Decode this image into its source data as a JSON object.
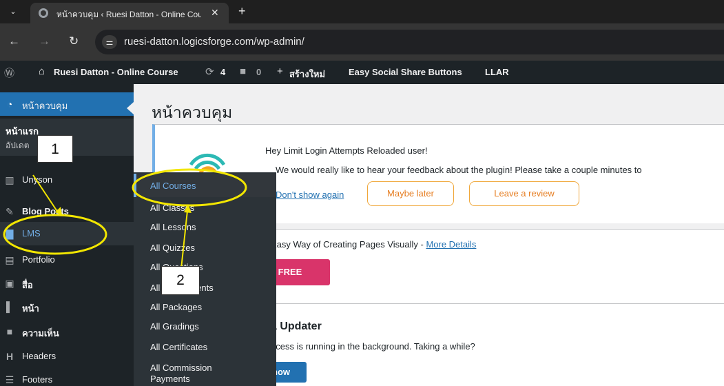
{
  "browser": {
    "tab_title": "หน้าควบคุม ‹ Ruesi Datton - Online Course",
    "url": "ruesi-datton.logicsforge.com/wp-admin/",
    "icons": [
      "chevron-down-icon",
      "globe-icon",
      "close-icon",
      "plus-icon",
      "back-icon",
      "forward-icon",
      "reload-icon",
      "site-info-icon"
    ]
  },
  "adminbar": {
    "site_name": "Ruesi Datton - Online Course",
    "updates_count": "4",
    "comments_count": "0",
    "new_label": "สร้างใหม่",
    "plugin_1": "Easy Social Share Buttons",
    "plugin_2": "LLAR"
  },
  "sidebar": {
    "dashboard": "หน้าควบคุม",
    "home": "หน้าแรก",
    "updates": "อัปเดต",
    "items": [
      {
        "label": "Unyson",
        "icon": "unyson-icon"
      },
      {
        "label": "Blog Posts",
        "icon": "pin-icon"
      },
      {
        "label": "LMS",
        "icon": "lms-icon"
      },
      {
        "label": "Portfolio",
        "icon": "portfolio-icon"
      },
      {
        "label": "สื่อ",
        "icon": "media-icon"
      },
      {
        "label": "หน้า",
        "icon": "page-icon"
      },
      {
        "label": "ความเห็น",
        "icon": "comment-icon"
      },
      {
        "label": "Headers",
        "icon": "headers-icon"
      },
      {
        "label": "Footers",
        "icon": "footers-icon"
      }
    ]
  },
  "flyout": {
    "items": [
      "All Courses",
      "All Classes",
      "All Lessons",
      "All Quizzes",
      "All Questions",
      "All Assignments",
      "All Packages",
      "All Gradings",
      "All Certificates",
      "All Commission",
      "Payments"
    ]
  },
  "main": {
    "page_title": "หน้าควบคุม",
    "notice": {
      "heading": "Hey Limit Login Attempts Reloaded user!",
      "text": "We would really like to hear your feedback about the plugin! Please take a couple minutes to",
      "dont_show": "Don't show again",
      "maybe_later": "Maybe later",
      "leave_review": "Leave a review"
    },
    "panel2": {
      "text": "Easy Way of Creating Pages Visually - ",
      "more_details": "More Details",
      "button": "r FREE"
    },
    "panel3": {
      "heading": "a Updater",
      "text": "ocess is running in the background. Taking a while?",
      "button": "now"
    }
  },
  "annotations": {
    "callout_1": "1",
    "callout_2": "2",
    "color": "#f2e600"
  },
  "colors": {
    "wp_dark": "#1d2327",
    "wp_blue": "#2271b1",
    "flyout_bg": "#2c3338",
    "orange": "#e67e22",
    "pink": "#d9346a"
  }
}
